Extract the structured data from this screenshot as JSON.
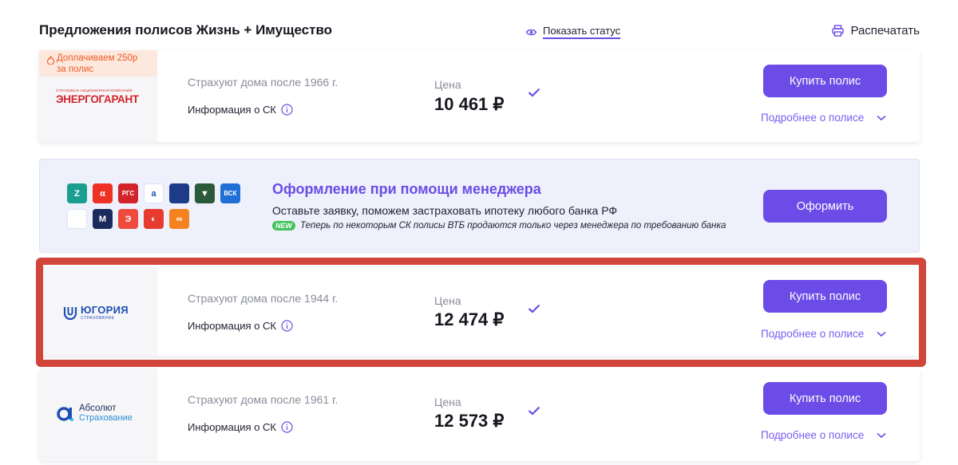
{
  "header": {
    "title": "Предложения полисов Жизнь + Имущество",
    "show_status": "Показать статус",
    "print": "Распечатать"
  },
  "offers": [
    {
      "promo": "Доплачиваем 250р за полис",
      "logo_small": "СТРАХОВАЯ АКЦИОНЕРНАЯ КОМПАНИЯ",
      "logo_text": "ЭНЕРГОГАРАНТ",
      "cover": "Страхуют дома после 1966 г.",
      "info": "Информация о СК",
      "price_label": "Цена",
      "price": "10 461 ₽",
      "buy": "Купить полис",
      "details": "Подробнее о полисе"
    },
    {
      "logo_text": "ЮГОРИЯ",
      "logo_small": "СТРАХОВАНИЕ",
      "cover": "Страхуют дома после 1944 г.",
      "info": "Информация о СК",
      "price_label": "Цена",
      "price": "12 474 ₽",
      "buy": "Купить полис",
      "details": "Подробнее о полисе"
    },
    {
      "logo_text": "Абсолют",
      "logo_small": "Страхование",
      "cover": "Страхуют дома после 1961 г.",
      "info": "Информация о СК",
      "price_label": "Цена",
      "price": "12 573 ₽",
      "buy": "Купить полис",
      "details": "Подробнее о полисе"
    }
  ],
  "manager": {
    "title": "Оформление при помощи менеджера",
    "subtitle": "Оставьте заявку, поможем застраховать ипотеку любого банка РФ",
    "new_badge": "NEW",
    "note": "Теперь по некоторым СК полисы ВТБ продаются только через менеджера по требованию банка",
    "button": "Оформить",
    "logos": [
      {
        "text": "Z",
        "color": "#1a9e8f"
      },
      {
        "text": "α",
        "color": "#ef3124"
      },
      {
        "text": "РГС",
        "color": "#d3232a"
      },
      {
        "text": "a",
        "color": "#ffffff"
      },
      {
        "text": "",
        "color": "#1e3b8a"
      },
      {
        "text": "▼",
        "color": "#2b5a3a"
      },
      {
        "text": "ВСК",
        "color": "#1f6fd6"
      },
      {
        "text": "",
        "color": "#ffffff"
      },
      {
        "text": "М",
        "color": "#1b2a5c"
      },
      {
        "text": "Э",
        "color": "#ee4b3d"
      },
      {
        "text": "◐",
        "color": "#e63b2e"
      },
      {
        "text": "∞",
        "color": "#f58220"
      }
    ]
  },
  "colors": {
    "accent": "#6b4ce6",
    "highlight": "#d1453b",
    "promo_bg": "#fde8dd",
    "promo_text": "#ee5a28"
  }
}
